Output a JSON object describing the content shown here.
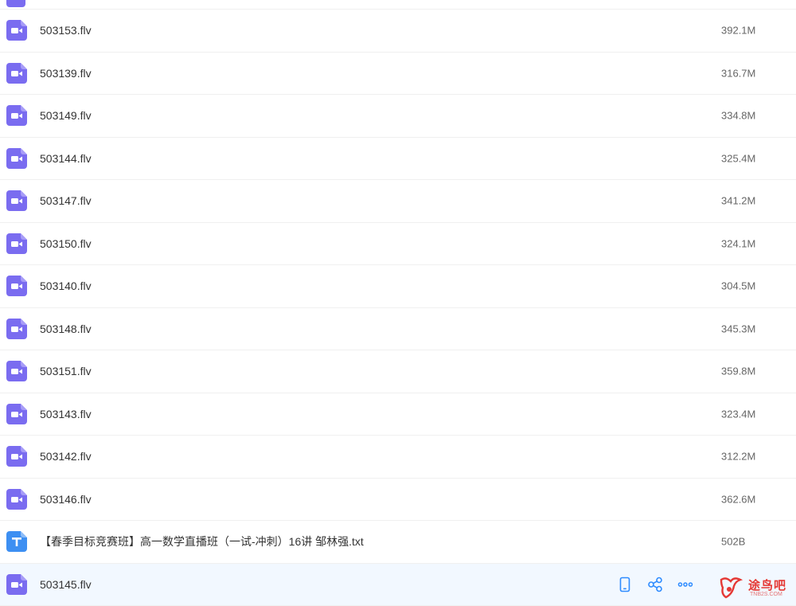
{
  "colors": {
    "video_icon": "#7a6cf0",
    "text_icon": "#3d8ff2",
    "action_icon": "#2f8cff",
    "hover_row": "#f2f8ff"
  },
  "files": [
    {
      "name": "503153.flv",
      "size": "392.1M",
      "icon": "video-file-icon"
    },
    {
      "name": "503139.flv",
      "size": "316.7M",
      "icon": "video-file-icon"
    },
    {
      "name": "503149.flv",
      "size": "334.8M",
      "icon": "video-file-icon"
    },
    {
      "name": "503144.flv",
      "size": "325.4M",
      "icon": "video-file-icon"
    },
    {
      "name": "503147.flv",
      "size": "341.2M",
      "icon": "video-file-icon"
    },
    {
      "name": "503150.flv",
      "size": "324.1M",
      "icon": "video-file-icon"
    },
    {
      "name": "503140.flv",
      "size": "304.5M",
      "icon": "video-file-icon"
    },
    {
      "name": "503148.flv",
      "size": "345.3M",
      "icon": "video-file-icon"
    },
    {
      "name": "503151.flv",
      "size": "359.8M",
      "icon": "video-file-icon"
    },
    {
      "name": "503143.flv",
      "size": "323.4M",
      "icon": "video-file-icon"
    },
    {
      "name": "503142.flv",
      "size": "312.2M",
      "icon": "video-file-icon"
    },
    {
      "name": "503146.flv",
      "size": "362.6M",
      "icon": "video-file-icon"
    },
    {
      "name": "【春季目标竞赛班】高一数学直播班（一试-冲刺）16讲 邹林强.txt",
      "size": "502B",
      "icon": "text-file-icon"
    },
    {
      "name": "503145.flv",
      "size": "",
      "icon": "video-file-icon"
    }
  ],
  "hover_actions": [
    "phone-icon",
    "share-icon",
    "more-icon"
  ],
  "watermark": {
    "text": "途鸟吧",
    "sub": "TNB2S.COM"
  }
}
